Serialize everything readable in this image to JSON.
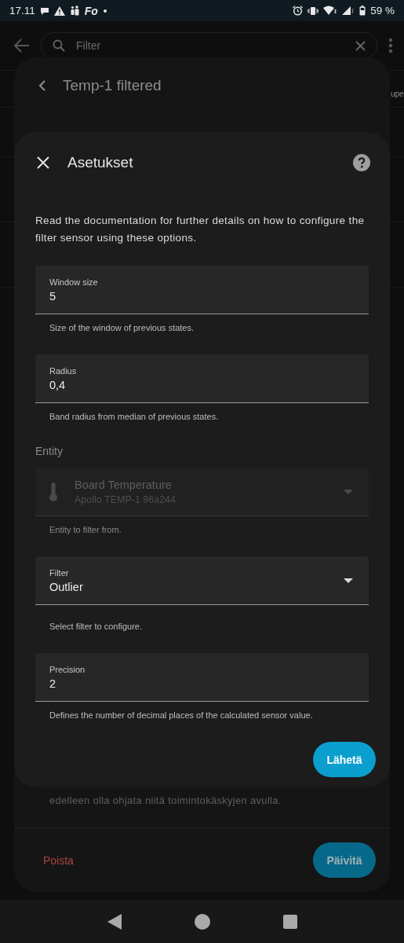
{
  "status_bar": {
    "time": "17.11",
    "app_badge": "Fo",
    "battery": "59 %"
  },
  "app_bar": {
    "search": {
      "placeholder": "Filter"
    }
  },
  "background": {
    "cut_text": "upe"
  },
  "entity_dialog": {
    "title": "Temp-1 filtered",
    "note": "edelleen olla ohjata niitä toimintokäskyjen avulla.",
    "delete_button": "Poista",
    "update_button": "Päivitä"
  },
  "options_dialog": {
    "title": "Asetukset",
    "description": "Read the documentation for further details on how to configure the filter sensor using these options.",
    "fields": [
      {
        "kind": "text",
        "label": "Window size",
        "value": "5",
        "helper": "Size of the window of previous states.",
        "disabled": false
      },
      {
        "kind": "text",
        "label": "Radius",
        "value": "0,4",
        "helper": "Band radius from median of previous states.",
        "disabled": false
      },
      {
        "kind": "entity",
        "heading": "Entity",
        "value": "Board Temperature",
        "secondary": "Apollo TEMP-1 96a244",
        "helper": "Entity to filter from.",
        "disabled": true
      },
      {
        "kind": "select",
        "label": "Filter",
        "value": "Outlier",
        "helper": "Select filter to configure.",
        "disabled": false
      },
      {
        "kind": "text",
        "label": "Precision",
        "value": "2",
        "helper": "Defines the number of decimal places of the calculated sensor value.",
        "disabled": false
      }
    ],
    "submit_button": "Lähetä"
  }
}
